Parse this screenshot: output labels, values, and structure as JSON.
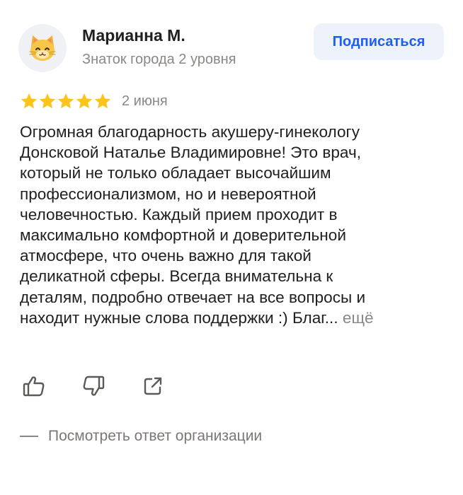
{
  "author": {
    "name": "Марианна М.",
    "level": "Знаток города 2 уровня",
    "avatar_icon": "cat-face-icon"
  },
  "subscribe_button": {
    "label": "Подписаться",
    "color": "#1d5ff2"
  },
  "rating": {
    "stars": 5,
    "max": 5,
    "star_color": "#fcc419",
    "date": "2 июня"
  },
  "review": {
    "lines": [
      "Огромная благодарность акушеру-гинекологу",
      "Донсковой Наталье Владимировне! Это врач,",
      "который не только обладает высочайшим",
      "профессионализмом, но и невероятной",
      "человечностью. Каждый прием проходит в",
      "максимально комфортной и доверительной",
      "атмосфере, что очень важно для такой",
      "деликатной сферы. Всегда внимательна к",
      "деталям, подробно отвечает на все вопросы и",
      "находит нужные слова поддержки :) Благ..."
    ],
    "more_label": "ещё"
  },
  "actions": {
    "like_icon": "thumbs-up-icon",
    "dislike_icon": "thumbs-down-icon",
    "share_icon": "share-icon"
  },
  "org_reply": {
    "label": "Посмотреть ответ организации"
  }
}
